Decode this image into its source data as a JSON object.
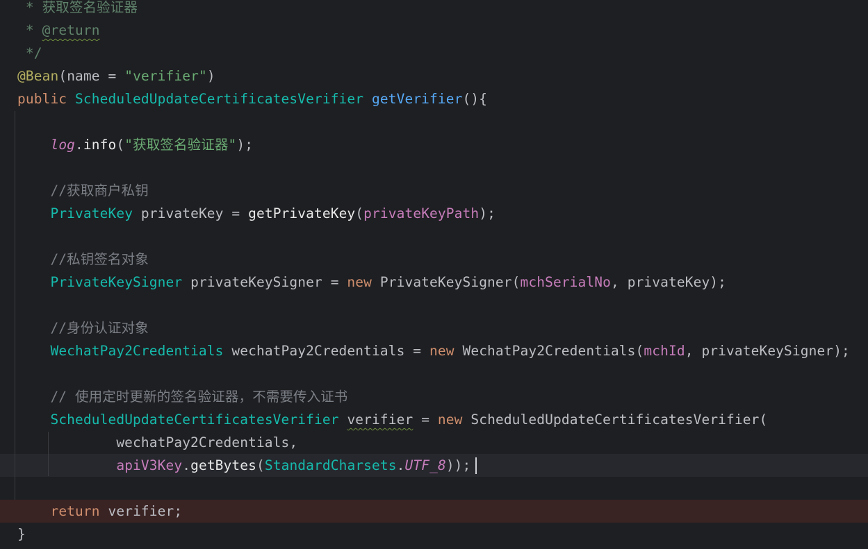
{
  "editor": {
    "lines": [
      {
        "tokens": [
          {
            "t": " * ",
            "c": "cm-doc"
          },
          {
            "t": "获取签名验证器",
            "c": "cm-doc cjk"
          }
        ]
      },
      {
        "tokens": [
          {
            "t": " * ",
            "c": "cm-doc"
          },
          {
            "t": "@return",
            "c": "cm-doc typo"
          }
        ]
      },
      {
        "tokens": [
          {
            "t": " */",
            "c": "cm-doc"
          }
        ]
      },
      {
        "tokens": [
          {
            "t": "@Bean",
            "c": "ann"
          },
          {
            "t": "(",
            "c": "plain"
          },
          {
            "t": "name",
            "c": "plain"
          },
          {
            "t": " = ",
            "c": "plain"
          },
          {
            "t": "\"verifier\"",
            "c": "st"
          },
          {
            "t": ")",
            "c": "plain"
          }
        ]
      },
      {
        "tokens": [
          {
            "t": "public ",
            "c": "kw"
          },
          {
            "t": "ScheduledUpdateCertificatesVerifier",
            "c": "ty"
          },
          {
            "t": " ",
            "c": "plain"
          },
          {
            "t": "getVerifier",
            "c": "fn"
          },
          {
            "t": "(){",
            "c": "plain"
          }
        ]
      },
      {
        "tokens": []
      },
      {
        "tokens": [
          {
            "t": "    ",
            "c": "plain"
          },
          {
            "t": "log",
            "c": "field ital"
          },
          {
            "t": ".",
            "c": "plain"
          },
          {
            "t": "info",
            "c": "mcall"
          },
          {
            "t": "(",
            "c": "plain"
          },
          {
            "t": "\"",
            "c": "st"
          },
          {
            "t": "获取签名验证器",
            "c": "st cjk"
          },
          {
            "t": "\"",
            "c": "st"
          },
          {
            "t": ");",
            "c": "plain"
          }
        ]
      },
      {
        "tokens": []
      },
      {
        "tokens": [
          {
            "t": "    //",
            "c": "cm"
          },
          {
            "t": "获取商户私钥",
            "c": "cm cjk"
          }
        ]
      },
      {
        "tokens": [
          {
            "t": "    ",
            "c": "plain"
          },
          {
            "t": "PrivateKey",
            "c": "ty"
          },
          {
            "t": " privateKey = ",
            "c": "plain"
          },
          {
            "t": "getPrivateKey",
            "c": "mcall"
          },
          {
            "t": "(",
            "c": "plain"
          },
          {
            "t": "privateKeyPath",
            "c": "field"
          },
          {
            "t": ");",
            "c": "plain"
          }
        ]
      },
      {
        "tokens": []
      },
      {
        "tokens": [
          {
            "t": "    //",
            "c": "cm"
          },
          {
            "t": "私钥签名对象",
            "c": "cm cjk"
          }
        ]
      },
      {
        "tokens": [
          {
            "t": "    ",
            "c": "plain"
          },
          {
            "t": "PrivateKeySigner",
            "c": "ty"
          },
          {
            "t": " privateKeySigner = ",
            "c": "plain"
          },
          {
            "t": "new ",
            "c": "kw"
          },
          {
            "t": "PrivateKeySigner",
            "c": "plain"
          },
          {
            "t": "(",
            "c": "plain"
          },
          {
            "t": "mchSerialNo",
            "c": "field"
          },
          {
            "t": ", privateKey);",
            "c": "plain"
          }
        ]
      },
      {
        "tokens": []
      },
      {
        "tokens": [
          {
            "t": "    //",
            "c": "cm"
          },
          {
            "t": "身份认证对象",
            "c": "cm cjk"
          }
        ]
      },
      {
        "tokens": [
          {
            "t": "    ",
            "c": "plain"
          },
          {
            "t": "WechatPay2Credentials",
            "c": "ty"
          },
          {
            "t": " wechatPay2Credentials = ",
            "c": "plain"
          },
          {
            "t": "new ",
            "c": "kw"
          },
          {
            "t": "WechatPay2Credentials",
            "c": "plain"
          },
          {
            "t": "(",
            "c": "plain"
          },
          {
            "t": "mchId",
            "c": "field"
          },
          {
            "t": ", privateKeySigner);",
            "c": "plain"
          }
        ]
      },
      {
        "tokens": []
      },
      {
        "tokens": [
          {
            "t": "    // ",
            "c": "cm"
          },
          {
            "t": "使用定时更新的签名验证器，不需要传入证书",
            "c": "cm cjk"
          }
        ]
      },
      {
        "tokens": [
          {
            "t": "    ",
            "c": "plain"
          },
          {
            "t": "ScheduledUpdateCertificatesVerifier",
            "c": "ty"
          },
          {
            "t": " ",
            "c": "plain"
          },
          {
            "t": "verifier",
            "c": "plain typo"
          },
          {
            "t": " = ",
            "c": "plain"
          },
          {
            "t": "new ",
            "c": "kw"
          },
          {
            "t": "ScheduledUpdateCertificatesVerifier",
            "c": "plain"
          },
          {
            "t": "(",
            "c": "plain"
          }
        ]
      },
      {
        "tokens": [
          {
            "t": "            wechatPay2Credentials,",
            "c": "plain"
          }
        ]
      },
      {
        "tokens": [
          {
            "t": "            ",
            "c": "plain"
          },
          {
            "t": "apiV3Key",
            "c": "field"
          },
          {
            "t": ".",
            "c": "plain"
          },
          {
            "t": "getBytes",
            "c": "mcall"
          },
          {
            "t": "(",
            "c": "plain"
          },
          {
            "t": "StandardCharsets",
            "c": "ty"
          },
          {
            "t": ".",
            "c": "plain"
          },
          {
            "t": "UTF_8",
            "c": "static-f"
          },
          {
            "t": "));",
            "c": "plain"
          }
        ]
      },
      {
        "tokens": []
      },
      {
        "tokens": [
          {
            "t": "    ",
            "c": "plain"
          },
          {
            "t": "return ",
            "c": "kw"
          },
          {
            "t": "verifier;",
            "c": "plain"
          }
        ]
      },
      {
        "tokens": [
          {
            "t": "}",
            "c": "plain"
          }
        ]
      }
    ]
  },
  "colors": {
    "background": "#1e1f22",
    "current_line": "#26282e",
    "breakpoint_line": "#3a2323"
  }
}
